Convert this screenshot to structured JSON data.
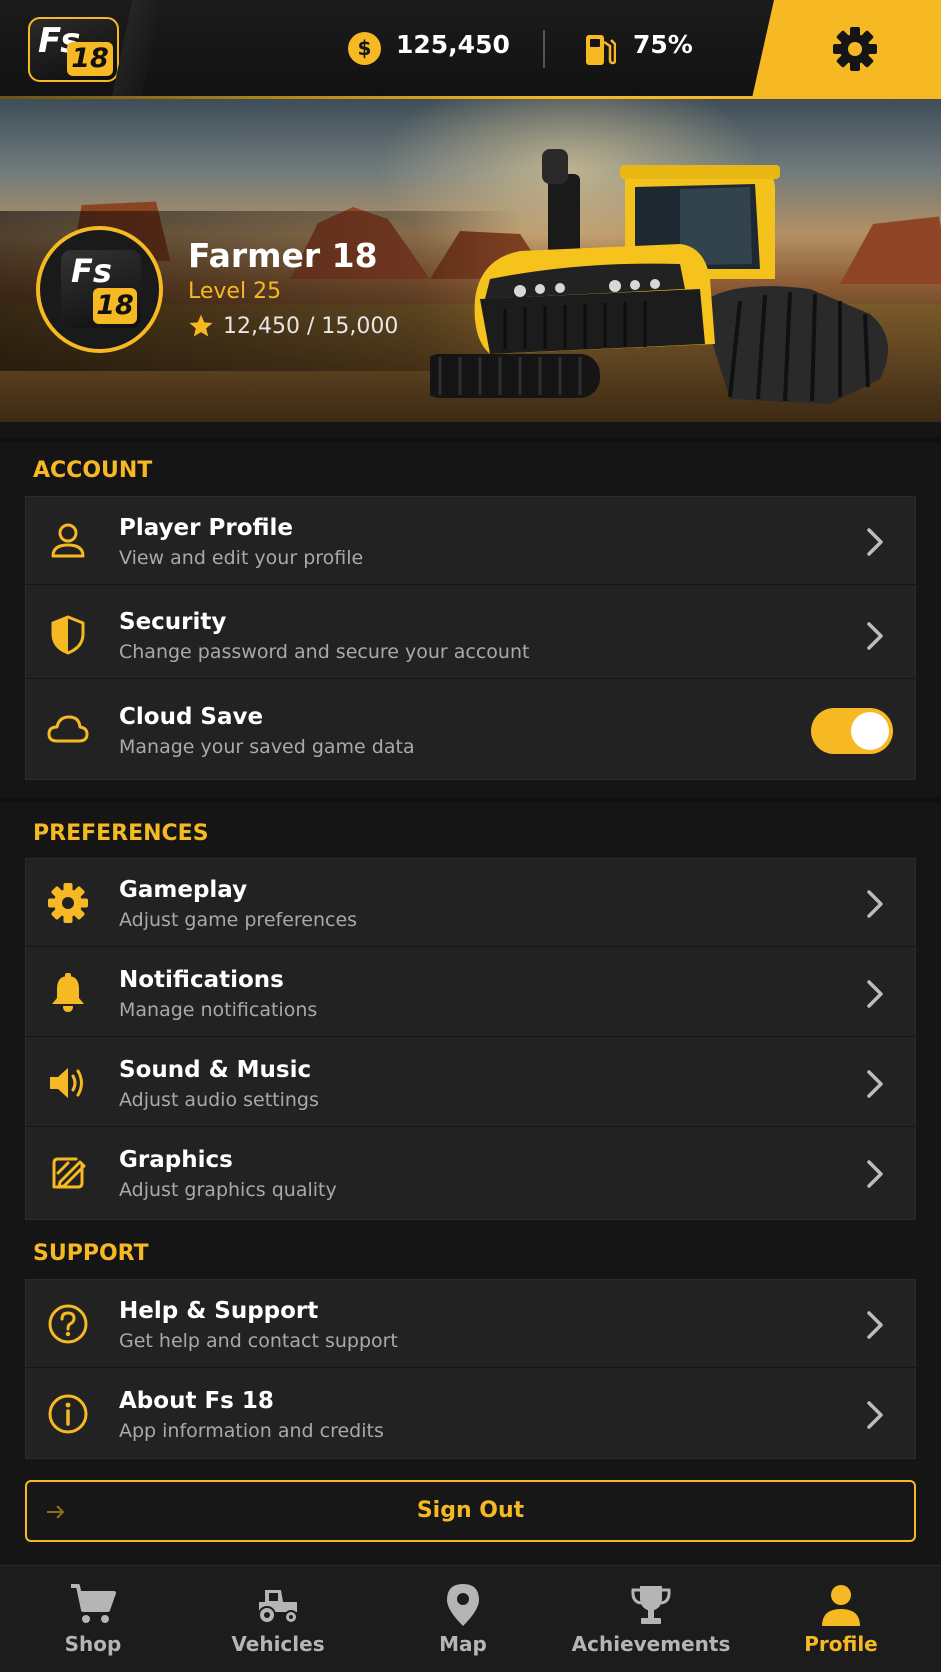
{
  "brand": {
    "logo_text": "Fs",
    "logo_number": "18"
  },
  "topbar": {
    "coin_symbol": "$",
    "money": "125,450",
    "fuel": "75%"
  },
  "profile": {
    "name": "Farmer 18",
    "level": "Level 25",
    "xp": "12,450 / 15,000"
  },
  "sections": {
    "account": {
      "title": "ACCOUNT",
      "items": [
        {
          "title": "Player Profile",
          "subtitle": "View and edit your profile",
          "icon": "user-icon"
        },
        {
          "title": "Security",
          "subtitle": "Change password and secure your account",
          "icon": "shield-icon"
        },
        {
          "title": "Cloud Save",
          "subtitle": "Manage your saved game data",
          "icon": "cloud-icon",
          "toggle_on": true
        }
      ]
    },
    "preferences": {
      "title": "PREFERENCES",
      "items": [
        {
          "title": "Gameplay",
          "subtitle": "Adjust game preferences",
          "icon": "gear-icon"
        },
        {
          "title": "Notifications",
          "subtitle": "Manage notifications",
          "icon": "bell-icon"
        },
        {
          "title": "Sound & Music",
          "subtitle": "Adjust audio settings",
          "icon": "speaker-icon"
        },
        {
          "title": "Graphics",
          "subtitle": "Adjust graphics quality",
          "icon": "graphics-icon"
        }
      ]
    },
    "support": {
      "title": "SUPPORT",
      "items": [
        {
          "title": "Help & Support",
          "subtitle": "Get help and contact support",
          "icon": "help-icon"
        },
        {
          "title": "About Fs 18",
          "subtitle": "App information and credits",
          "icon": "info-icon"
        }
      ]
    }
  },
  "sign_out": "Sign Out",
  "nav": [
    {
      "label": "Shop",
      "icon": "cart-icon"
    },
    {
      "label": "Vehicles",
      "icon": "tractor-icon"
    },
    {
      "label": "Map",
      "icon": "map-pin-icon"
    },
    {
      "label": "Achievements",
      "icon": "trophy-icon"
    },
    {
      "label": "Profile",
      "icon": "person-icon",
      "active": true
    }
  ],
  "colors": {
    "accent": "#f6b923",
    "background": "#151515",
    "card": "#222222",
    "muted_text": "#a9a9a9"
  }
}
